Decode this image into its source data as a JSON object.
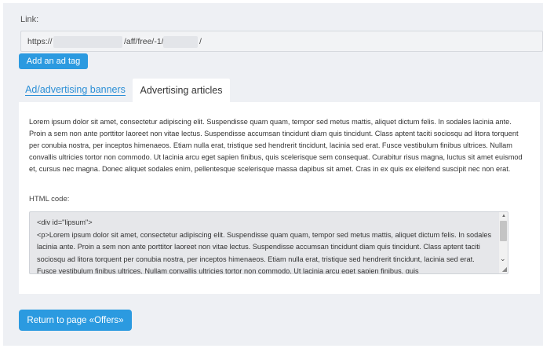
{
  "link": {
    "label": "Link:",
    "prefix": "https://",
    "middle": "/aff/free/-1/",
    "suffix": "/"
  },
  "add_ad_tag_label": "Add an ad tag",
  "tabs": [
    {
      "label": "Ad/advertising banners",
      "active": false
    },
    {
      "label": "Advertising articles",
      "active": true
    }
  ],
  "article": {
    "text": "Lorem ipsum dolor sit amet, consectetur adipiscing elit. Suspendisse quam quam, tempor sed metus mattis, aliquet dictum felis. In sodales lacinia ante. Proin a sem non ante porttitor laoreet non vitae lectus. Suspendisse accumsan tincidunt diam quis tincidunt. Class aptent taciti sociosqu ad litora torquent per conubia nostra, per inceptos himenaeos. Etiam nulla erat, tristique sed hendrerit tincidunt, lacinia sed erat. Fusce vestibulum finibus ultrices. Nullam convallis ultricies tortor non commodo. Ut lacinia arcu eget sapien finibus, quis scelerisque sem consequat. Curabitur risus magna, luctus sit amet euismod et, cursus nec magna. Donec aliquet sodales enim, pellentesque scelerisque massa dapibus sit amet. Cras in ex quis ex eleifend suscipit nec non erat.",
    "html_code_label": "HTML code:",
    "html_code_line1": "<div id=\"lipsum\">",
    "html_code_rest": "<p>Lorem ipsum dolor sit amet, consectetur adipiscing elit. Suspendisse quam quam, tempor sed metus mattis, aliquet dictum felis. In sodales lacinia ante. Proin a sem non ante porttitor laoreet non vitae lectus. Suspendisse accumsan tincidunt diam quis tincidunt. Class aptent taciti sociosqu ad litora torquent per conubia nostra, per inceptos himenaeos. Etiam nulla erat, tristique sed hendrerit tincidunt, lacinia sed erat. Fusce vestibulum finibus ultrices. Nullam convallis ultricies tortor non commodo. Ut lacinia arcu eget sapien finibus, quis"
  },
  "return_button_label": "Return to page «Offers»",
  "colors": {
    "accent": "#2b9ae0",
    "tab_link": "#2b8fd6",
    "panel_bg": "#eef0f4"
  }
}
